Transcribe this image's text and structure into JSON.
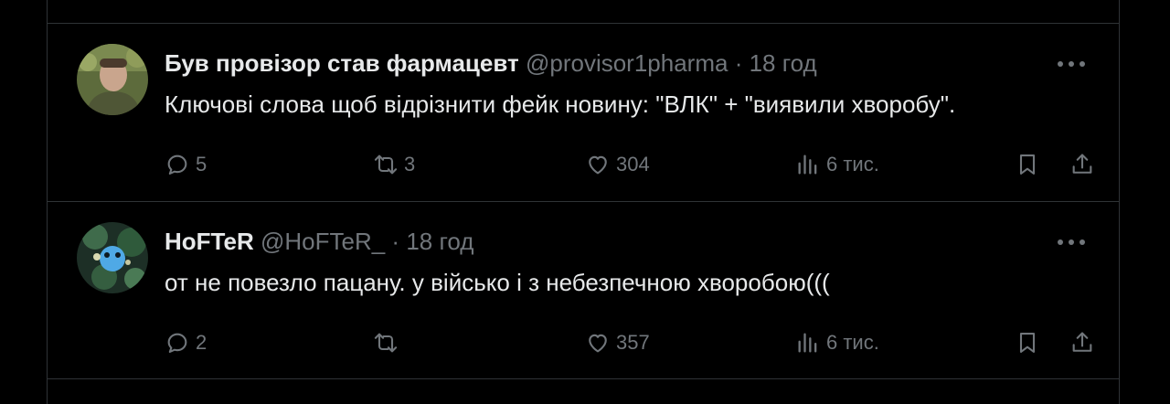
{
  "tweets": [
    {
      "display_name": "Був провізор став фармацевт",
      "handle": "@provisor1pharma",
      "separator": "·",
      "time": "18 год",
      "text": "Ключові слова щоб відрізнити фейк новину: \"ВЛК\" + \"виявили хворобу\".",
      "replies": "5",
      "retweets": "3",
      "likes": "304",
      "views": "6 тис."
    },
    {
      "display_name": "HoFTeR",
      "handle": "@HoFTeR_",
      "separator": "·",
      "time": "18 год",
      "text": "от не повезло пацану. у військо і з небезпечною хворобою(((",
      "replies": "2",
      "retweets": "",
      "likes": "357",
      "views": "6 тис."
    }
  ],
  "icons": {
    "reply": "reply-icon",
    "retweet": "retweet-icon",
    "like": "heart-icon",
    "views": "views-icon",
    "bookmark": "bookmark-icon",
    "share": "share-icon",
    "more": "more-icon"
  },
  "colors": {
    "background": "#000000",
    "text": "#e7e9ea",
    "muted": "#71767b",
    "border": "#2f3336"
  }
}
